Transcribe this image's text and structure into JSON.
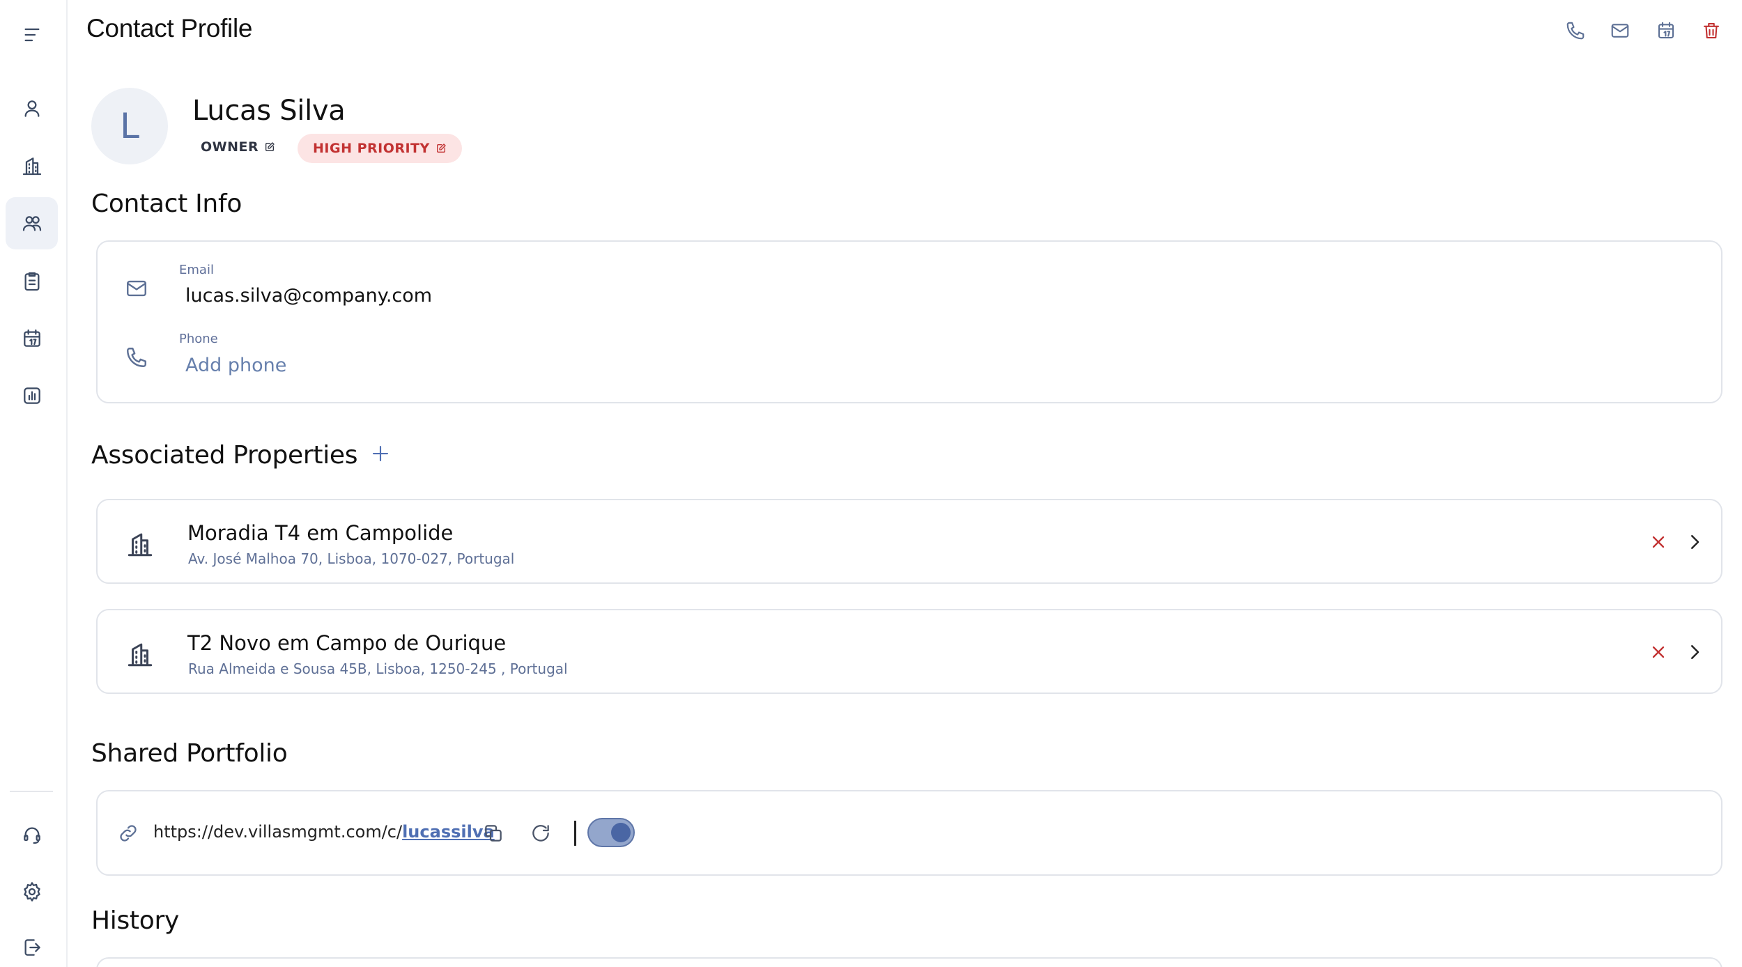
{
  "header": {
    "title": "Contact Profile",
    "actions": [
      {
        "name": "call-button",
        "icon": "phone-icon",
        "color": "#5d7095"
      },
      {
        "name": "email-button",
        "icon": "mail-icon",
        "color": "#5d7095"
      },
      {
        "name": "schedule-button",
        "icon": "calendar-icon",
        "color": "#5d7095"
      },
      {
        "name": "delete-button",
        "icon": "trash-icon",
        "color": "#c23232"
      }
    ]
  },
  "sidebar": {
    "items": [
      {
        "icon": "menu-icon"
      },
      {
        "icon": "user-icon"
      },
      {
        "icon": "building-icon"
      },
      {
        "icon": "users-icon",
        "active": true
      },
      {
        "icon": "clipboard-icon"
      },
      {
        "icon": "calendar-icon"
      },
      {
        "icon": "chart-icon"
      },
      {
        "icon": "headset-icon"
      },
      {
        "icon": "gear-icon"
      },
      {
        "icon": "logout-icon"
      }
    ]
  },
  "profile": {
    "initial": "L",
    "name": "Lucas Silva",
    "role": "OWNER",
    "priority": "HIGH PRIORITY"
  },
  "contact_info": {
    "title": "Contact Info",
    "email_label": "Email",
    "email_value": "lucas.silva@company.com",
    "phone_label": "Phone",
    "phone_placeholder": "Add phone"
  },
  "properties": {
    "title": "Associated Properties",
    "items": [
      {
        "title": "Moradia T4 em Campolide",
        "address": "Av. José Malhoa 70, Lisboa, 1070-027, Portugal"
      },
      {
        "title": "T2 Novo em Campo de Ourique",
        "address": "Rua Almeida e Sousa 45B, Lisboa, 1250-245 , Portugal"
      }
    ]
  },
  "portfolio": {
    "title": "Shared Portfolio",
    "url_base": "https://dev.villasmgmt.com/c/",
    "url_slug": "lucassilva",
    "enabled": true
  },
  "history": {
    "title": "History"
  },
  "colors": {
    "accent": "#4f6fb3",
    "danger": "#c23232",
    "priority_bg": "#fce4e4",
    "muted_text": "#60709a"
  }
}
